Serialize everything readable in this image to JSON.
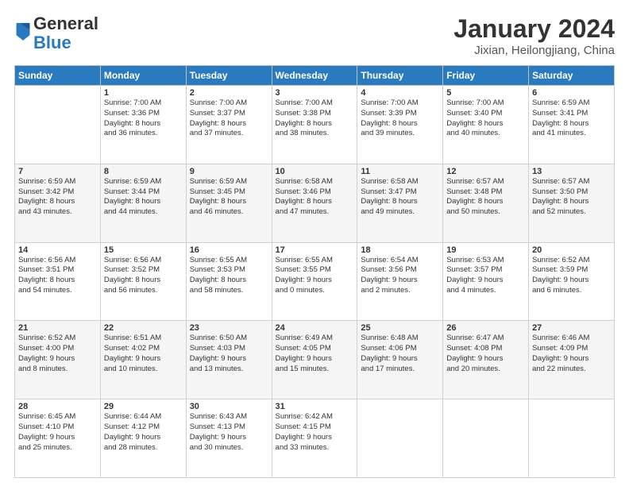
{
  "header": {
    "logo_general": "General",
    "logo_blue": "Blue",
    "month": "January 2024",
    "location": "Jixian, Heilongjiang, China"
  },
  "weekdays": [
    "Sunday",
    "Monday",
    "Tuesday",
    "Wednesday",
    "Thursday",
    "Friday",
    "Saturday"
  ],
  "weeks": [
    [
      {
        "day": "",
        "info": ""
      },
      {
        "day": "1",
        "info": "Sunrise: 7:00 AM\nSunset: 3:36 PM\nDaylight: 8 hours\nand 36 minutes."
      },
      {
        "day": "2",
        "info": "Sunrise: 7:00 AM\nSunset: 3:37 PM\nDaylight: 8 hours\nand 37 minutes."
      },
      {
        "day": "3",
        "info": "Sunrise: 7:00 AM\nSunset: 3:38 PM\nDaylight: 8 hours\nand 38 minutes."
      },
      {
        "day": "4",
        "info": "Sunrise: 7:00 AM\nSunset: 3:39 PM\nDaylight: 8 hours\nand 39 minutes."
      },
      {
        "day": "5",
        "info": "Sunrise: 7:00 AM\nSunset: 3:40 PM\nDaylight: 8 hours\nand 40 minutes."
      },
      {
        "day": "6",
        "info": "Sunrise: 6:59 AM\nSunset: 3:41 PM\nDaylight: 8 hours\nand 41 minutes."
      }
    ],
    [
      {
        "day": "7",
        "info": "Sunrise: 6:59 AM\nSunset: 3:42 PM\nDaylight: 8 hours\nand 43 minutes."
      },
      {
        "day": "8",
        "info": "Sunrise: 6:59 AM\nSunset: 3:44 PM\nDaylight: 8 hours\nand 44 minutes."
      },
      {
        "day": "9",
        "info": "Sunrise: 6:59 AM\nSunset: 3:45 PM\nDaylight: 8 hours\nand 46 minutes."
      },
      {
        "day": "10",
        "info": "Sunrise: 6:58 AM\nSunset: 3:46 PM\nDaylight: 8 hours\nand 47 minutes."
      },
      {
        "day": "11",
        "info": "Sunrise: 6:58 AM\nSunset: 3:47 PM\nDaylight: 8 hours\nand 49 minutes."
      },
      {
        "day": "12",
        "info": "Sunrise: 6:57 AM\nSunset: 3:48 PM\nDaylight: 8 hours\nand 50 minutes."
      },
      {
        "day": "13",
        "info": "Sunrise: 6:57 AM\nSunset: 3:50 PM\nDaylight: 8 hours\nand 52 minutes."
      }
    ],
    [
      {
        "day": "14",
        "info": "Sunrise: 6:56 AM\nSunset: 3:51 PM\nDaylight: 8 hours\nand 54 minutes."
      },
      {
        "day": "15",
        "info": "Sunrise: 6:56 AM\nSunset: 3:52 PM\nDaylight: 8 hours\nand 56 minutes."
      },
      {
        "day": "16",
        "info": "Sunrise: 6:55 AM\nSunset: 3:53 PM\nDaylight: 8 hours\nand 58 minutes."
      },
      {
        "day": "17",
        "info": "Sunrise: 6:55 AM\nSunset: 3:55 PM\nDaylight: 9 hours\nand 0 minutes."
      },
      {
        "day": "18",
        "info": "Sunrise: 6:54 AM\nSunset: 3:56 PM\nDaylight: 9 hours\nand 2 minutes."
      },
      {
        "day": "19",
        "info": "Sunrise: 6:53 AM\nSunset: 3:57 PM\nDaylight: 9 hours\nand 4 minutes."
      },
      {
        "day": "20",
        "info": "Sunrise: 6:52 AM\nSunset: 3:59 PM\nDaylight: 9 hours\nand 6 minutes."
      }
    ],
    [
      {
        "day": "21",
        "info": "Sunrise: 6:52 AM\nSunset: 4:00 PM\nDaylight: 9 hours\nand 8 minutes."
      },
      {
        "day": "22",
        "info": "Sunrise: 6:51 AM\nSunset: 4:02 PM\nDaylight: 9 hours\nand 10 minutes."
      },
      {
        "day": "23",
        "info": "Sunrise: 6:50 AM\nSunset: 4:03 PM\nDaylight: 9 hours\nand 13 minutes."
      },
      {
        "day": "24",
        "info": "Sunrise: 6:49 AM\nSunset: 4:05 PM\nDaylight: 9 hours\nand 15 minutes."
      },
      {
        "day": "25",
        "info": "Sunrise: 6:48 AM\nSunset: 4:06 PM\nDaylight: 9 hours\nand 17 minutes."
      },
      {
        "day": "26",
        "info": "Sunrise: 6:47 AM\nSunset: 4:08 PM\nDaylight: 9 hours\nand 20 minutes."
      },
      {
        "day": "27",
        "info": "Sunrise: 6:46 AM\nSunset: 4:09 PM\nDaylight: 9 hours\nand 22 minutes."
      }
    ],
    [
      {
        "day": "28",
        "info": "Sunrise: 6:45 AM\nSunset: 4:10 PM\nDaylight: 9 hours\nand 25 minutes."
      },
      {
        "day": "29",
        "info": "Sunrise: 6:44 AM\nSunset: 4:12 PM\nDaylight: 9 hours\nand 28 minutes."
      },
      {
        "day": "30",
        "info": "Sunrise: 6:43 AM\nSunset: 4:13 PM\nDaylight: 9 hours\nand 30 minutes."
      },
      {
        "day": "31",
        "info": "Sunrise: 6:42 AM\nSunset: 4:15 PM\nDaylight: 9 hours\nand 33 minutes."
      },
      {
        "day": "",
        "info": ""
      },
      {
        "day": "",
        "info": ""
      },
      {
        "day": "",
        "info": ""
      }
    ]
  ]
}
